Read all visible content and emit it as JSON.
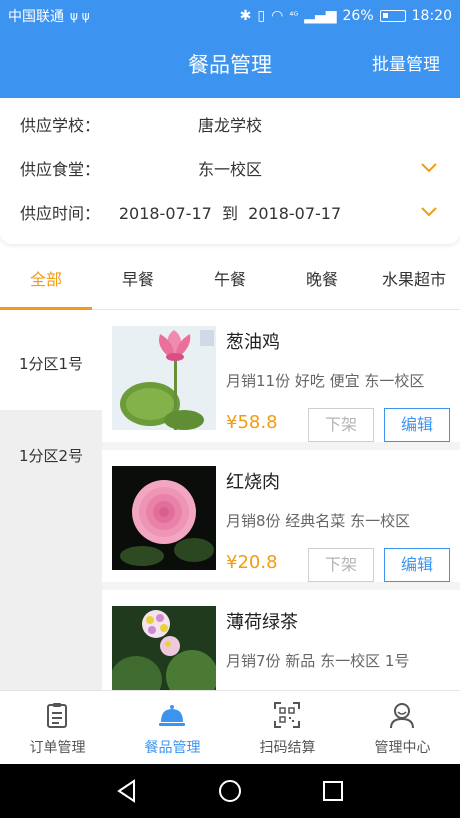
{
  "status_bar": {
    "carrier": "中国联通",
    "usb_icons": "ψ ψ",
    "network": "⁴ᴳ",
    "battery": "26%",
    "time": "18:20"
  },
  "header": {
    "title": "餐品管理",
    "batch_label": "批量管理"
  },
  "filters": {
    "school_label": "供应学校：",
    "school_value": "唐龙学校",
    "canteen_label": "供应食堂：",
    "canteen_value": "东一校区",
    "time_label": "供应时间：",
    "time_start": "2018-07-17",
    "time_sep": "到",
    "time_end": "2018-07-17"
  },
  "tabs": [
    {
      "label": "全部",
      "active": true
    },
    {
      "label": "早餐"
    },
    {
      "label": "午餐"
    },
    {
      "label": "晚餐"
    },
    {
      "label": "水果超市"
    }
  ],
  "zones": [
    {
      "label": "1分区1号",
      "active": true
    },
    {
      "label": "1分区2号"
    }
  ],
  "items": [
    {
      "name": "葱油鸡",
      "desc": "月销11份  好吃  便宜  东一校区",
      "price": "¥58.8",
      "off_label": "下架",
      "edit_label": "编辑",
      "image": "pink-lotus"
    },
    {
      "name": "红烧肉",
      "desc": "月销8份  经典名菜  东一校区",
      "price": "¥20.8",
      "off_label": "下架",
      "edit_label": "编辑",
      "image": "pink-rose"
    },
    {
      "name": "薄荷绿茶",
      "desc": "月销7份  新品  东一校区  1号",
      "price": "",
      "off_label": "",
      "edit_label": "",
      "image": "lantana-flowers"
    }
  ],
  "bottom_nav": [
    {
      "label": "订单管理",
      "icon": "clipboard-icon"
    },
    {
      "label": "餐品管理",
      "icon": "cloche-icon",
      "active": true
    },
    {
      "label": "扫码结算",
      "icon": "qr-scan-icon"
    },
    {
      "label": "管理中心",
      "icon": "user-icon"
    }
  ],
  "colors": {
    "primary": "#3d94f0",
    "accent": "#f39c12"
  }
}
